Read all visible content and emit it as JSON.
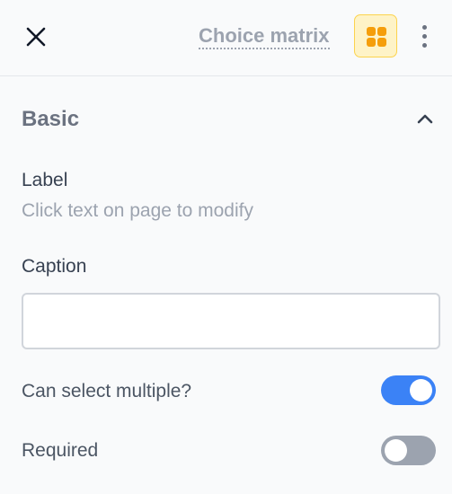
{
  "header": {
    "title": "Choice matrix",
    "close_icon": "close-icon",
    "type_icon": "grid-four-dots-icon",
    "more_icon": "more-vertical-icon"
  },
  "section": {
    "title": "Basic",
    "collapse_icon": "chevron-up-icon"
  },
  "fields": {
    "label": {
      "title": "Label",
      "hint": "Click text on page to modify"
    },
    "caption": {
      "title": "Caption",
      "value": "",
      "placeholder": ""
    },
    "can_select_multiple": {
      "title": "Can select multiple?",
      "checked": true
    },
    "required": {
      "title": "Required",
      "checked": false
    }
  },
  "colors": {
    "accent": "#3b82f6",
    "type_icon": "#f59e0b",
    "toggle_off": "#9ca3af"
  }
}
